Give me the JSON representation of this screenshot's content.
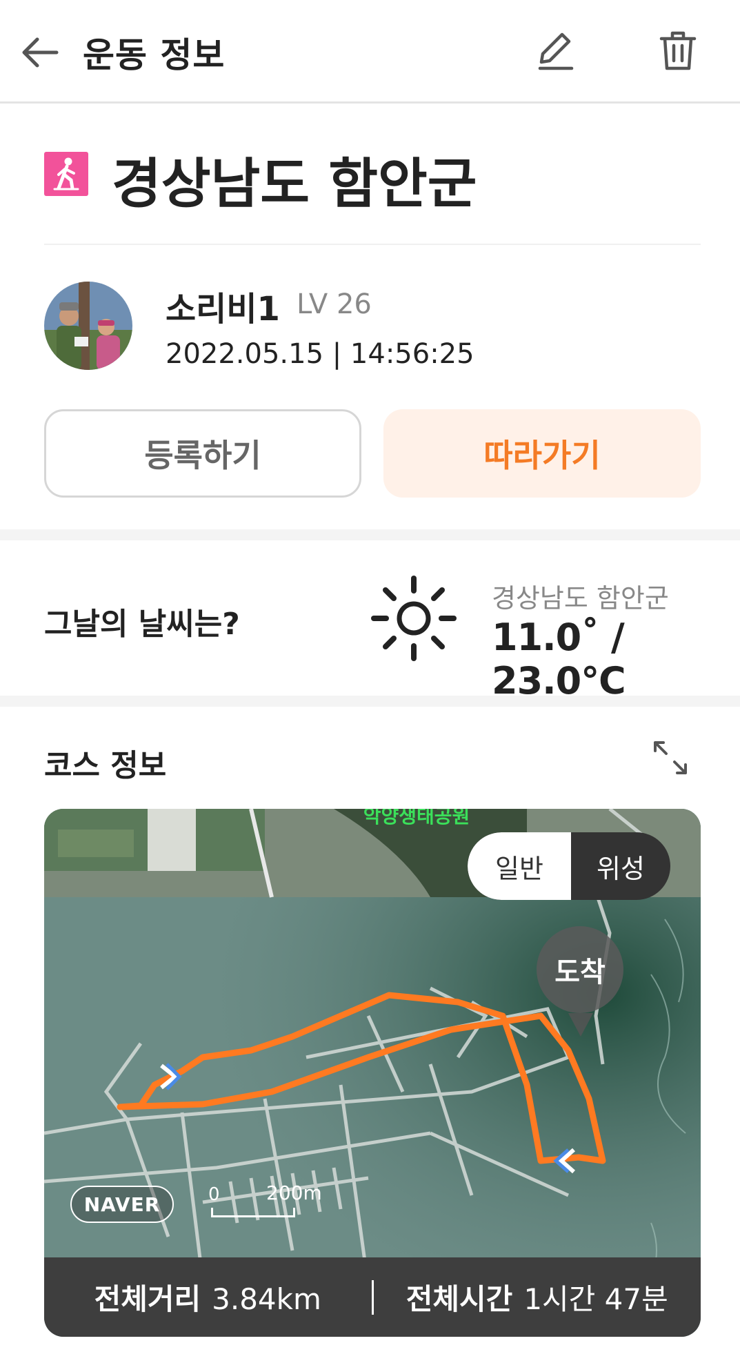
{
  "header": {
    "title": "운동 정보",
    "back_icon": "arrow-left-icon",
    "edit_icon": "pencil-icon",
    "delete_icon": "trash-icon"
  },
  "activity": {
    "type_icon": "walking-icon",
    "type_color": "#f2529a",
    "place": "경상남도 함안군"
  },
  "user": {
    "name": "소리비1",
    "level": "LV 26",
    "datetime": "2022.05.15 | 14:56:25"
  },
  "actions": {
    "register_label": "등록하기",
    "follow_label": "따라가기",
    "follow_color": "#f47b25"
  },
  "weather": {
    "question": "그날의 날씨는?",
    "icon": "sun-icon",
    "location": "경상남도 함안군",
    "temperature": "11.0˚ / 23.0℃"
  },
  "course": {
    "title": "코스 정보",
    "expand_icon": "expand-icon",
    "map": {
      "toggle_normal": "일반",
      "toggle_satellite": "위성",
      "toggle_selected": "위성",
      "place_label": "악양생태공원",
      "arrive_label": "도착",
      "provider": "NAVER",
      "scale_zero": "0",
      "scale_label": "200m",
      "route_color": "#ff7a21"
    },
    "stats": {
      "distance_label": "전체거리",
      "distance_value": "3.84km",
      "time_label": "전체시간",
      "time_value": "1시간 47분"
    }
  }
}
